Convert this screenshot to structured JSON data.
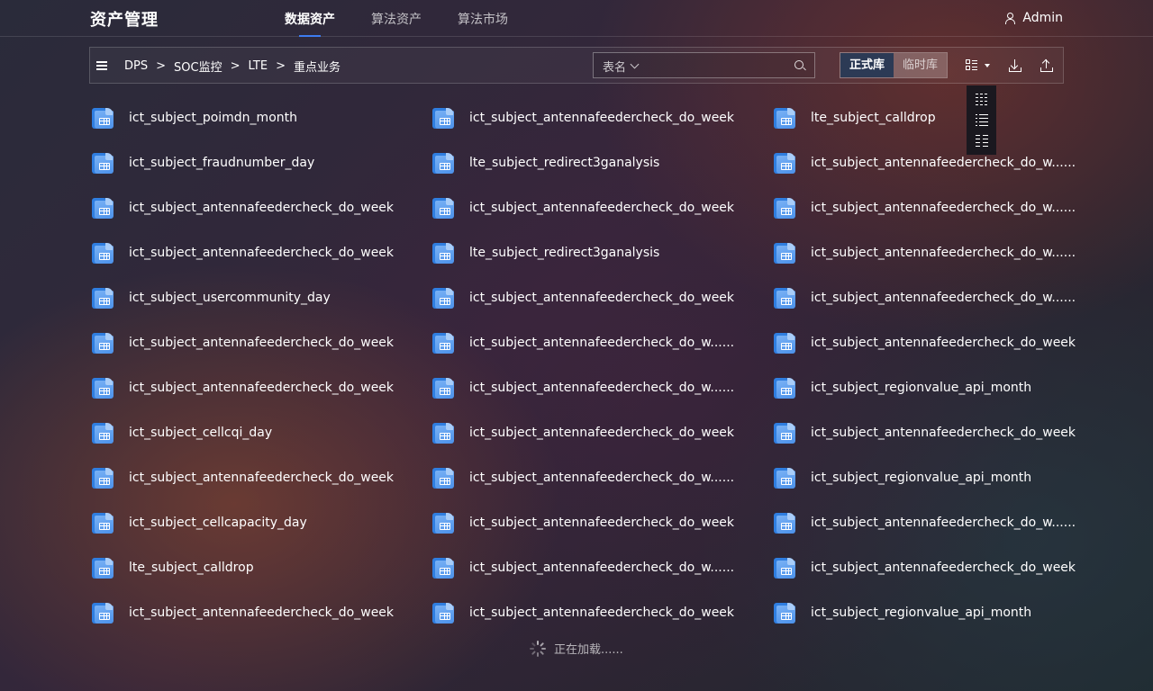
{
  "header": {
    "title": "资产管理",
    "tabs": [
      {
        "label": "数据资产",
        "active": true
      },
      {
        "label": "算法资产",
        "active": false
      },
      {
        "label": "算法市场",
        "active": false
      }
    ],
    "user": "Admin",
    "accent_color": "#3d7cf0"
  },
  "toolbar": {
    "menu_icon": "hamburger-menu-icon",
    "breadcrumb": [
      "DPS",
      "SOC监控",
      "LTE",
      "重点业务"
    ],
    "breadcrumb_separator": ">",
    "search": {
      "select_label": "表名",
      "value": "",
      "placeholder": ""
    },
    "db_toggle": {
      "active": "正式库",
      "inactive": "临时库"
    },
    "view_icon": "grid-view-icon",
    "download_icon": "download-icon",
    "upload_icon": "upload-icon"
  },
  "view_menu": {
    "options": [
      "grid-view-icon",
      "list-view-icon",
      "detail-list-icon"
    ]
  },
  "items": [
    "ict_subject_poimdn_month",
    "ict_subject_antennafeedercheck_do_week",
    "lte_subject_calldrop",
    "ict_subject_fraudnumber_day",
    "lte_subject_redirect3ganalysis",
    "ict_subject_antennafeedercheck_do_w......",
    "ict_subject_antennafeedercheck_do_week",
    "ict_subject_antennafeedercheck_do_week",
    "ict_subject_antennafeedercheck_do_w......",
    "ict_subject_antennafeedercheck_do_week",
    "lte_subject_redirect3ganalysis",
    "ict_subject_antennafeedercheck_do_w......",
    "ict_subject_usercommunity_day",
    "ict_subject_antennafeedercheck_do_week",
    "ict_subject_antennafeedercheck_do_w......",
    "ict_subject_antennafeedercheck_do_week",
    "ict_subject_antennafeedercheck_do_w......",
    "ict_subject_antennafeedercheck_do_week",
    "ict_subject_antennafeedercheck_do_week",
    "ict_subject_antennafeedercheck_do_w......",
    "ict_subject_regionvalue_api_month",
    "ict_subject_cellcqi_day",
    "ict_subject_antennafeedercheck_do_week",
    "ict_subject_antennafeedercheck_do_week",
    "ict_subject_antennafeedercheck_do_week",
    "ict_subject_antennafeedercheck_do_w......",
    "ict_subject_regionvalue_api_month",
    "ict_subject_cellcapacity_day",
    "ict_subject_antennafeedercheck_do_week",
    "ict_subject_antennafeedercheck_do_w......",
    "lte_subject_calldrop",
    "ict_subject_antennafeedercheck_do_w......",
    "ict_subject_antennafeedercheck_do_week",
    "ict_subject_antennafeedercheck_do_week",
    "ict_subject_antennafeedercheck_do_week",
    "ict_subject_regionvalue_api_month"
  ],
  "item_icon": "table-file-icon",
  "loading": {
    "text": "正在加载......",
    "icon": "spinner-icon"
  }
}
